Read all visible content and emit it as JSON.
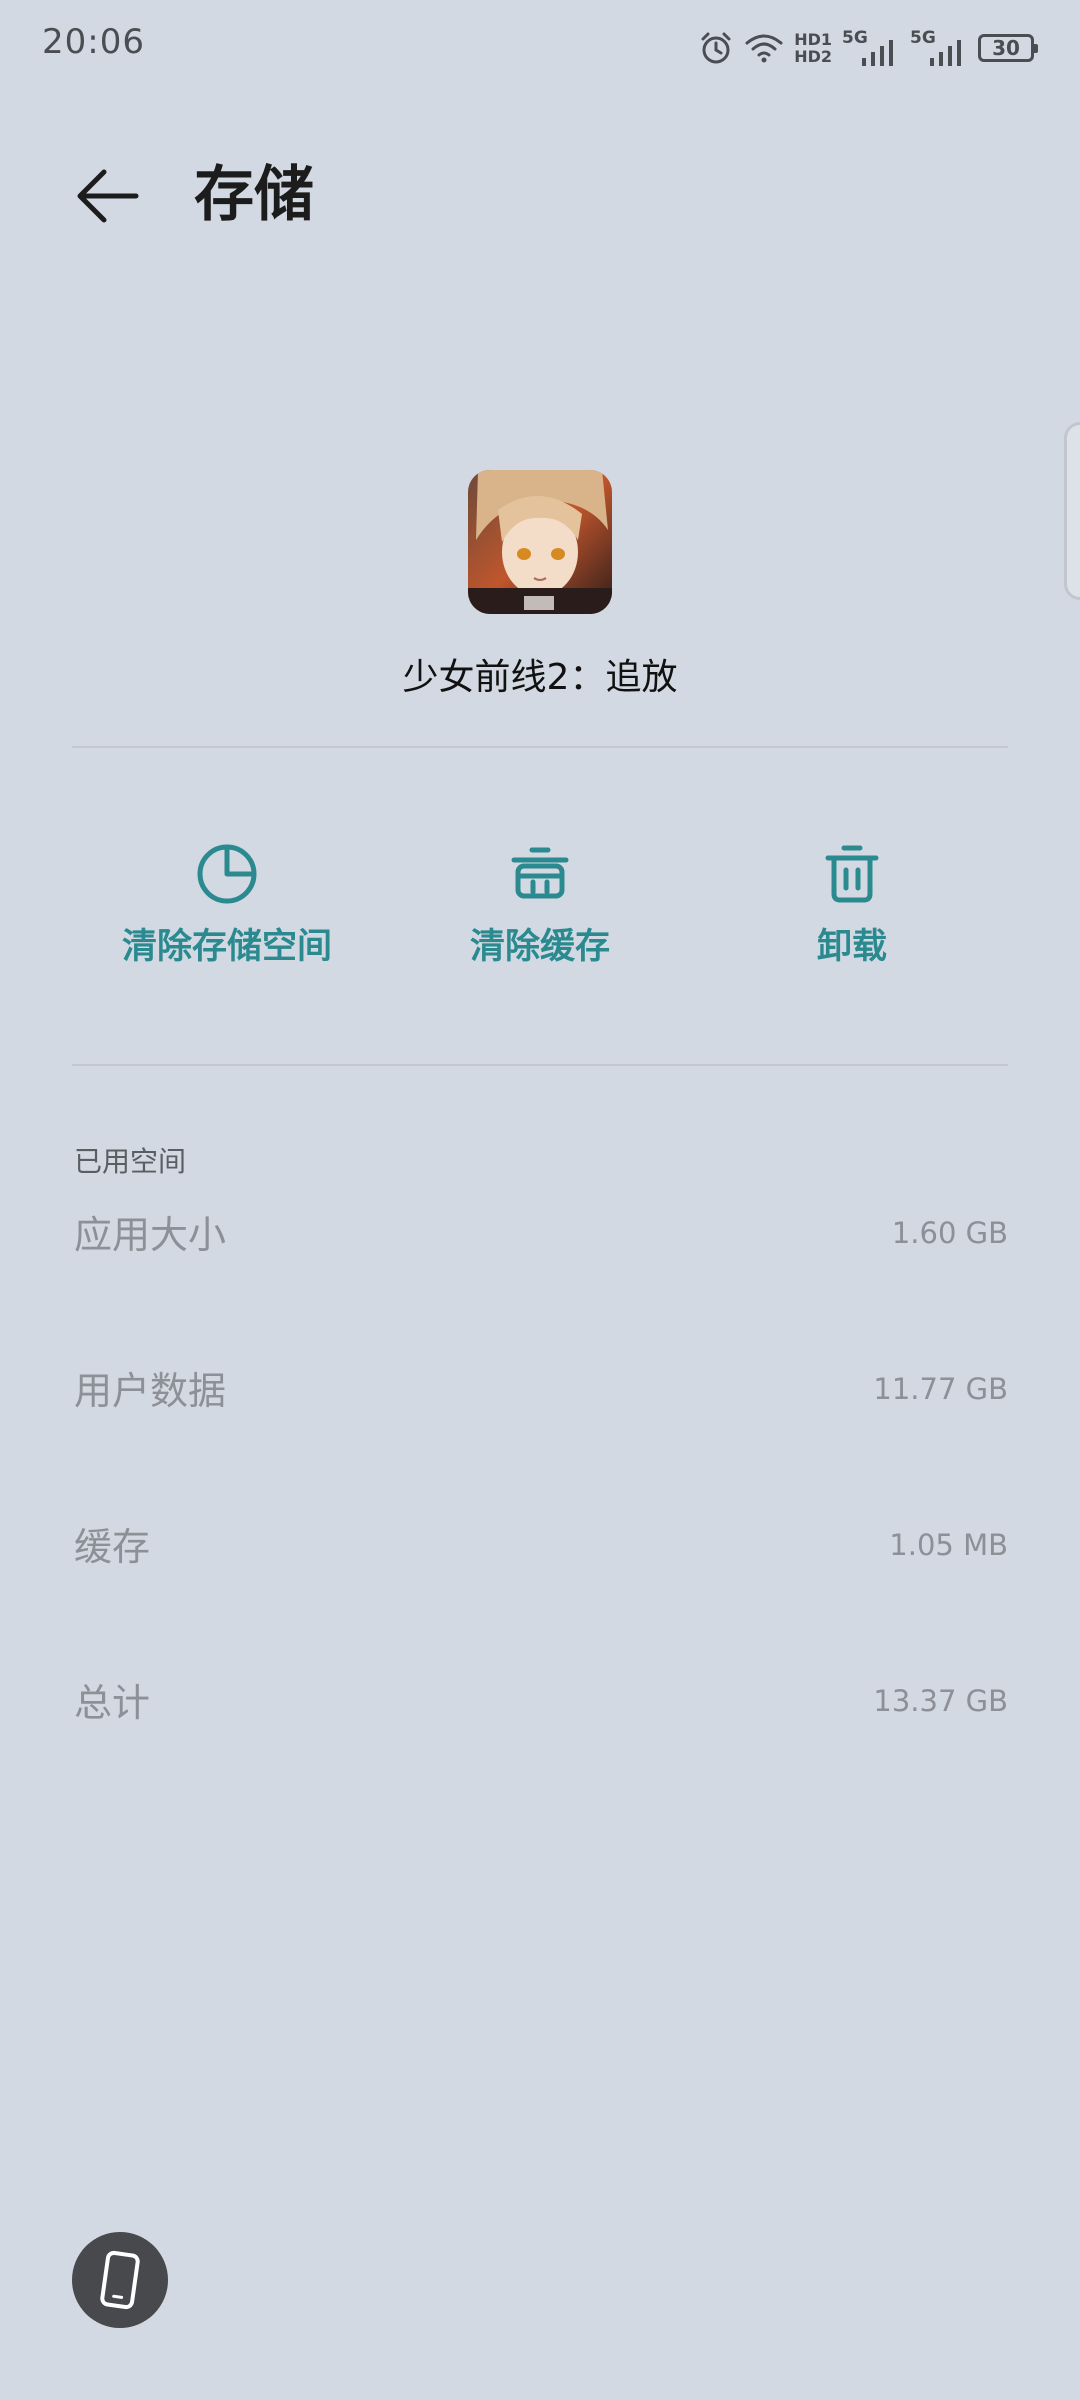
{
  "status_bar": {
    "time": "20:06",
    "hd_top": "HD1",
    "hd_bottom": "HD2",
    "signal1": "5G",
    "signal2": "5G",
    "battery": "30"
  },
  "header": {
    "title": "存储"
  },
  "app": {
    "name": "少女前线2：追放"
  },
  "actions": [
    {
      "label": "清除存储空间",
      "icon": "pie-chart-icon"
    },
    {
      "label": "清除缓存",
      "icon": "basket-trash-icon"
    },
    {
      "label": "卸载",
      "icon": "trash-can-icon"
    }
  ],
  "usage": {
    "section_label": "已用空间",
    "rows": [
      {
        "label": "应用大小",
        "value": "1.60 GB"
      },
      {
        "label": "用户数据",
        "value": "11.77 GB"
      },
      {
        "label": "缓存",
        "value": "1.05 MB"
      },
      {
        "label": "总计",
        "value": "13.37 GB"
      }
    ]
  },
  "colors": {
    "background": "#d3d9e2",
    "accent": "#2a8a8f"
  }
}
